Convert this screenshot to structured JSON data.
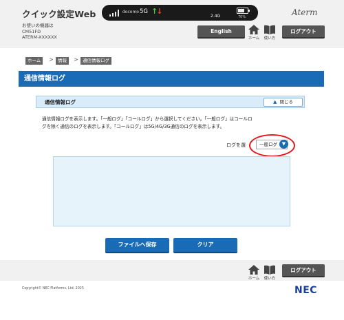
{
  "header": {
    "app_title": "クイック設定Web",
    "brand": "Aterm",
    "device_label": "お使いの機器は",
    "device_model": "CM51FD",
    "device_name": "ATERM-XXXXXX",
    "english_button": "English",
    "home_label": "ホーム",
    "manual_label": "使い方",
    "logout_button": "ログアウト"
  },
  "status_bar": {
    "carrier": "docomo",
    "network": "5G",
    "speed": "2.4G",
    "battery_percent": "70%",
    "battery_level": 0.7
  },
  "breadcrumb": {
    "items": [
      "ホーム",
      "情報",
      "通信情報ログ"
    ],
    "separator": ">"
  },
  "page_title": "通信情報ログ",
  "panel": {
    "title": "通信情報ログ",
    "close_button": "閉じる",
    "description_line1": "通信情報ログを表示します。「一般ログ」「コールログ」から選択してください。「一般ログ」はコールロ",
    "description_line2": "グを除く通信のログを表示します。「コールログ」は5G/4G/3G通信のログを表示します。",
    "select_label": "ログを選",
    "select_value": "一般ログ",
    "log_content": ""
  },
  "actions": {
    "save_button": "ファイルへ保存",
    "clear_button": "クリア"
  },
  "footer": {
    "home_label": "ホーム",
    "manual_label": "使い方",
    "logout_button": "ログアウト",
    "copyright": "Copyright© NEC Platforms, Ltd. 2025",
    "logo": "NEC"
  },
  "colors": {
    "accent_blue": "#1a6bb5",
    "highlight_red": "#e3191d",
    "header_gray": "#f1f1f1"
  }
}
